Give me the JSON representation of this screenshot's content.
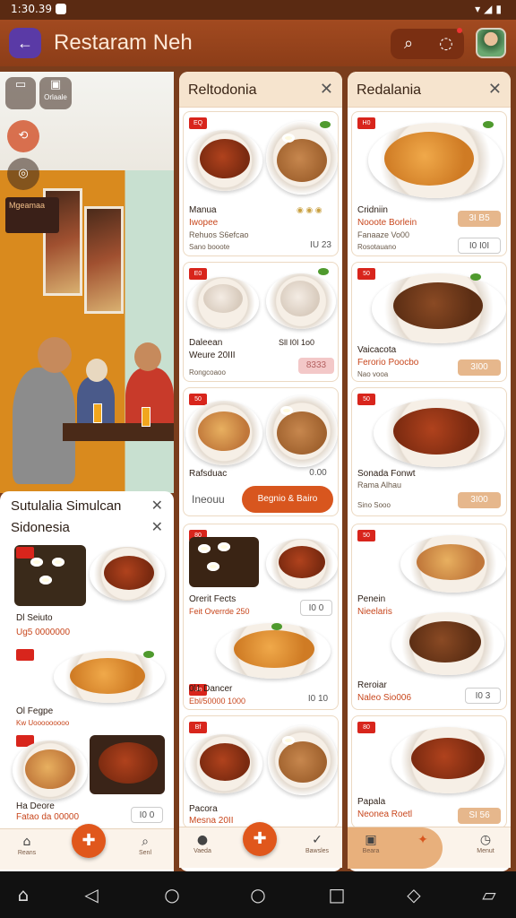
{
  "status_bar": {
    "time": "1:30.39"
  },
  "app_bar": {
    "title": "Restaram Neh"
  },
  "photo_tools": [
    {
      "label": "",
      "icon": "book-icon"
    },
    {
      "label": "Orlaale",
      "icon": "calendar-icon"
    }
  ],
  "photo_sign": "Mgeamaa",
  "left_panel": {
    "title_line1": "Sutulalia Simulcan",
    "title_line2": "Sidonesia",
    "items": [
      {
        "name": "Dl Seiuto",
        "sub": "Ug5 0000000"
      },
      {
        "name": "Ol Fegpe",
        "sub": "Kw Uooooooooo"
      },
      {
        "name": "Ha Deore",
        "sub": "Fatao da 00000",
        "price": "I0 0"
      }
    ],
    "nav": [
      "Reans",
      "",
      "Senl"
    ]
  },
  "middle_panel": {
    "title": "Reltodonia",
    "cards": [
      {
        "tag": "EQ",
        "name": "Manua",
        "sub": "Iwopee",
        "desc": "Rehuos S6efcao",
        "meta": "Sano booote",
        "price": "IU 23"
      },
      {
        "tag": "E0",
        "name": "Daleean",
        "name2": "Weure 20III",
        "meta": "Rongcoaoo",
        "price2": "Sll I0I 1o0",
        "price": "8333"
      },
      {
        "tag": "50",
        "name": "Rafsduac",
        "price": "0.00"
      },
      {
        "tag": "80",
        "name": "Orerit Fects",
        "sub": "Feit Overrde 250",
        "price": "I0 0"
      },
      {
        "tag": "Uo",
        "name": "0l1 Dancer",
        "sub": "Ebl/50000 1000",
        "price": "I0 10"
      },
      {
        "tag": "Bf",
        "name": "Pacora",
        "name2": "Mesna 20II"
      }
    ],
    "input_label": "Ineouu",
    "add_button": "Begnio & Bairo",
    "nav": [
      "Vaeda",
      "",
      "Bawsles"
    ]
  },
  "right_panel": {
    "title": "Redalania",
    "cards": [
      {
        "tag": "H0",
        "name": "Cridniin",
        "sub": "Nooote Borlein",
        "desc": "Fanaaze Vo00",
        "meta": "Rosotauano",
        "price": "3I B5",
        "price2": "I0 I0I"
      },
      {
        "tag": "50",
        "name": "Vaicacota",
        "sub": "Ferorio Poocbo",
        "meta": "Nao vooa",
        "price": "3I00"
      },
      {
        "tag": "50",
        "name": "Sonada Fonwt",
        "sub": "Rama Alhau",
        "meta": "Sino Sooo",
        "price": "3I00"
      },
      {
        "tag": "50",
        "name": "Penein",
        "sub": "Nieelaris",
        "name2": "Reroiar",
        "sub2": "Naleo Sio006",
        "price": "I0 3"
      },
      {
        "tag": "80",
        "name": "Papala",
        "sub": "Neonea Roetl",
        "price": "SI 56"
      }
    ],
    "nav": [
      "Beara",
      "",
      "Menut"
    ]
  }
}
